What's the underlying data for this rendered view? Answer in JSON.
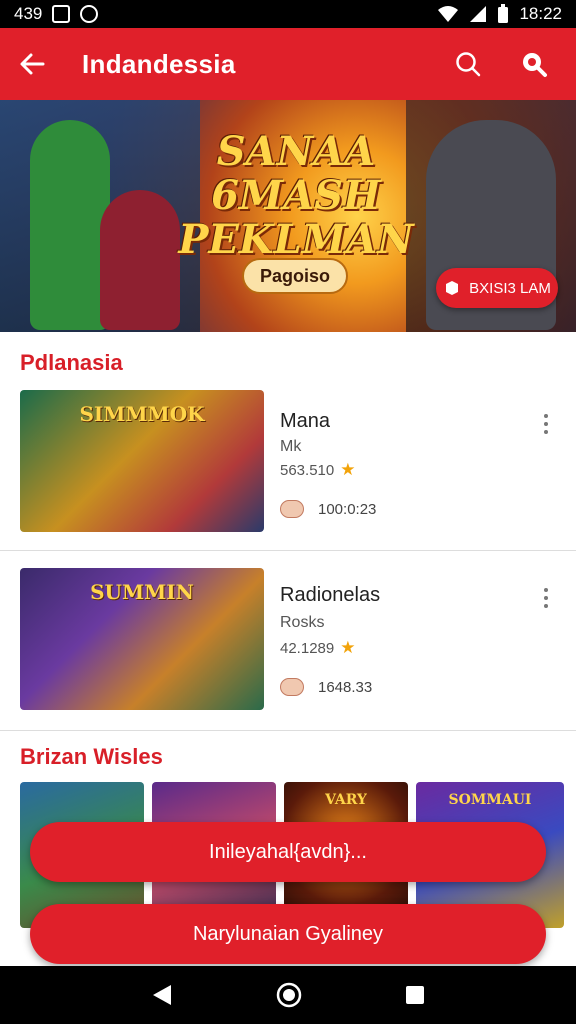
{
  "status_bar": {
    "time_left": "439",
    "time_right": "18:22"
  },
  "app_bar": {
    "title": "Indandessia",
    "back_icon": "arrow-left-icon",
    "actions": [
      "search-icon",
      "search-alt-icon"
    ]
  },
  "hero": {
    "title_line1": "SANAA 6MASH",
    "title_line2": "PEKLMAN",
    "promo_label": "Pagoiso",
    "cta_label": "BXISI3 LAM"
  },
  "section1": {
    "title": "Pdlanasia",
    "items": [
      {
        "thumb_text": "SIMMMOK",
        "name": "Mana",
        "subtitle": "Mk",
        "rating": "563.510",
        "meta": "100:0:23"
      },
      {
        "thumb_text": "SUMMIN",
        "name": "Radionelas",
        "subtitle": "Rosks",
        "rating": "42.1289",
        "meta": "1648.33"
      }
    ]
  },
  "section2": {
    "title": "Brizan Wisles",
    "thumbs": [
      "",
      "",
      "VARY",
      "SOMMAUI"
    ]
  },
  "buttons": {
    "primary": "Inileyahal{avdn}...",
    "secondary": "Narylunaian Gyaliney"
  },
  "colors": {
    "accent": "#e0202a",
    "section_title": "#d81f28",
    "star": "#f2a30a"
  }
}
